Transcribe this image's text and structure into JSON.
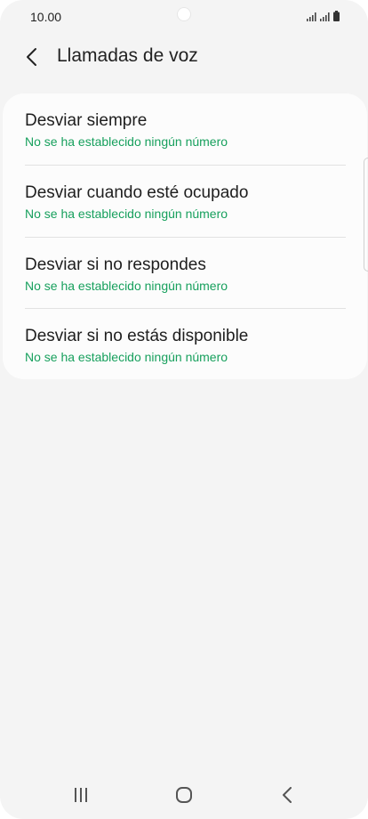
{
  "status_bar": {
    "time": "10.00",
    "icons": [
      "signal-icon",
      "signal-icon",
      "battery-icon"
    ]
  },
  "header": {
    "back_icon": "chevron-left-icon",
    "title": "Llamadas de voz"
  },
  "forwarding_options": [
    {
      "title": "Desviar siempre",
      "subtitle": "No se ha establecido ningún número"
    },
    {
      "title": "Desviar cuando esté ocupado",
      "subtitle": "No se ha establecido ningún número"
    },
    {
      "title": "Desviar si no respondes",
      "subtitle": "No se ha establecido ningún número"
    },
    {
      "title": "Desviar si no estás disponible",
      "subtitle": "No se ha establecido ningún número"
    }
  ],
  "colors": {
    "background": "#f4f4f4",
    "card": "#fcfcfc",
    "subtitle_accent": "#17a05d",
    "text_primary": "#1e1e1e"
  },
  "nav_bar": {
    "icons": [
      "recents-icon",
      "home-icon",
      "back-icon"
    ]
  }
}
